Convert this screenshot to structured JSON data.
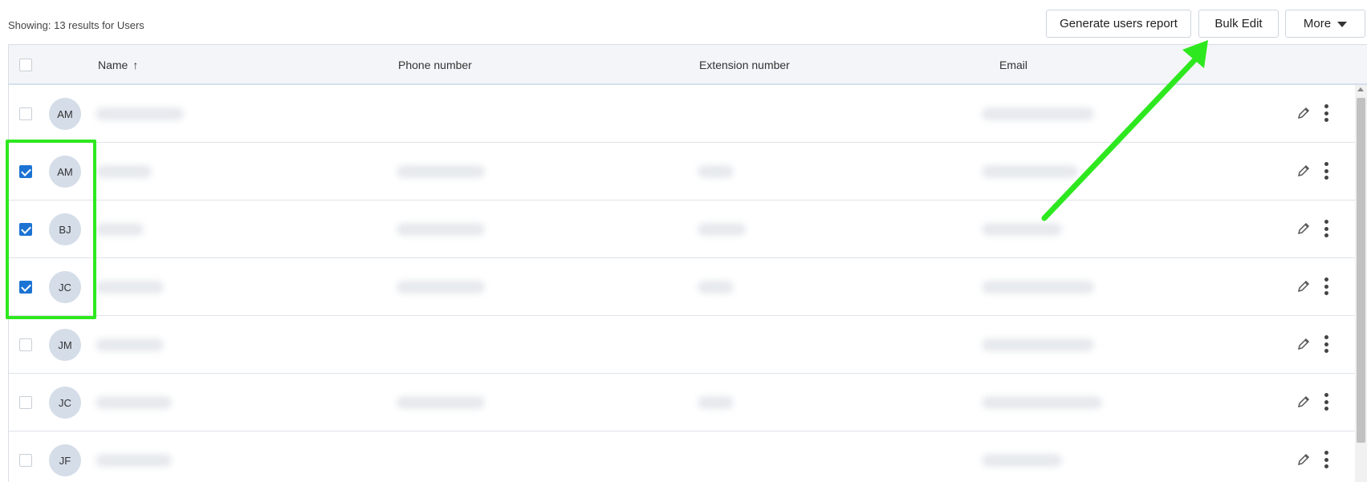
{
  "header": {
    "results_text": "Showing: 13 results for Users",
    "buttons": {
      "report": "Generate users report",
      "bulk_edit": "Bulk Edit",
      "more": "More"
    }
  },
  "table": {
    "columns": {
      "name": "Name",
      "phone": "Phone number",
      "extension": "Extension number",
      "email": "Email"
    },
    "sort_icon": "↑",
    "rows": [
      {
        "initials": "AM",
        "checked": false
      },
      {
        "initials": "AM",
        "checked": true
      },
      {
        "initials": "BJ",
        "checked": true
      },
      {
        "initials": "JC",
        "checked": true
      },
      {
        "initials": "JM",
        "checked": false
      },
      {
        "initials": "JC",
        "checked": false
      },
      {
        "initials": "JF",
        "checked": false
      }
    ]
  },
  "colors": {
    "accent": "#1b73d3",
    "annotation": "#2ee81f"
  }
}
